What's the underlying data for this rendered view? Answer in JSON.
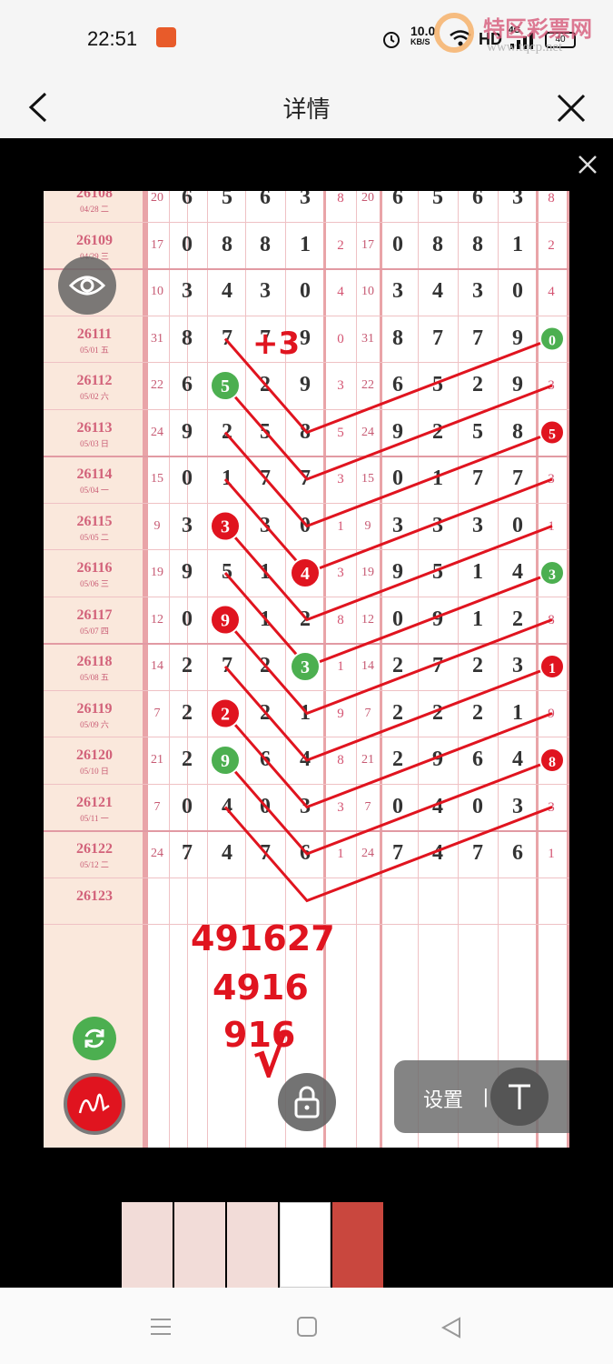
{
  "status_bar": {
    "time": "22:51",
    "network_speed_value": "10.0",
    "network_speed_unit": "KB/S",
    "hd_label": "HD",
    "signal_label": "4G",
    "battery": "40"
  },
  "watermark": {
    "title": "特区彩票网",
    "url": "www.tqcp.net"
  },
  "nav": {
    "title": "详情"
  },
  "sheet": {
    "rows": [
      {
        "issue": "26108",
        "date": "04/28 二",
        "sum_left": "20",
        "digits_left": [
          "6",
          "5",
          "6",
          "3"
        ],
        "tail_left": "8",
        "sum_right": "20",
        "digits_right": [
          "6",
          "5",
          "6",
          "3"
        ],
        "tail_right": "8"
      },
      {
        "issue": "26109",
        "date": "04/29 三",
        "sum_left": "17",
        "digits_left": [
          "0",
          "8",
          "8",
          "1"
        ],
        "tail_left": "2",
        "sum_right": "17",
        "digits_right": [
          "0",
          "8",
          "8",
          "1"
        ],
        "tail_right": "2"
      },
      {
        "issue": "",
        "date": "",
        "sum_left": "10",
        "digits_left": [
          "3",
          "4",
          "3",
          "0"
        ],
        "tail_left": "4",
        "sum_right": "10",
        "digits_right": [
          "3",
          "4",
          "3",
          "0"
        ],
        "tail_right": "4"
      },
      {
        "issue": "26111",
        "date": "05/01 五",
        "sum_left": "31",
        "digits_left": [
          "8",
          "7",
          "7",
          "9"
        ],
        "tail_left": "0",
        "sum_right": "31",
        "digits_right": [
          "8",
          "7",
          "7",
          "9"
        ],
        "tail_right": "0"
      },
      {
        "issue": "26112",
        "date": "05/02 六",
        "sum_left": "22",
        "digits_left": [
          "6",
          "5",
          "2",
          "9"
        ],
        "tail_left": "3",
        "sum_right": "22",
        "digits_right": [
          "6",
          "5",
          "2",
          "9"
        ],
        "tail_right": "3"
      },
      {
        "issue": "26113",
        "date": "05/03 日",
        "sum_left": "24",
        "digits_left": [
          "9",
          "2",
          "5",
          "8"
        ],
        "tail_left": "5",
        "sum_right": "24",
        "digits_right": [
          "9",
          "2",
          "5",
          "8"
        ],
        "tail_right": "5"
      },
      {
        "issue": "26114",
        "date": "05/04 一",
        "sum_left": "15",
        "digits_left": [
          "0",
          "1",
          "7",
          "7"
        ],
        "tail_left": "3",
        "sum_right": "15",
        "digits_right": [
          "0",
          "1",
          "7",
          "7"
        ],
        "tail_right": "3"
      },
      {
        "issue": "26115",
        "date": "05/05 二",
        "sum_left": "9",
        "digits_left": [
          "3",
          "3",
          "3",
          "0"
        ],
        "tail_left": "1",
        "sum_right": "9",
        "digits_right": [
          "3",
          "3",
          "3",
          "0"
        ],
        "tail_right": "1"
      },
      {
        "issue": "26116",
        "date": "05/06 三",
        "sum_left": "19",
        "digits_left": [
          "9",
          "5",
          "1",
          "4"
        ],
        "tail_left": "3",
        "sum_right": "19",
        "digits_right": [
          "9",
          "5",
          "1",
          "4"
        ],
        "tail_right": "3"
      },
      {
        "issue": "26117",
        "date": "05/07 四",
        "sum_left": "12",
        "digits_left": [
          "0",
          "9",
          "1",
          "2"
        ],
        "tail_left": "8",
        "sum_right": "12",
        "digits_right": [
          "0",
          "9",
          "1",
          "2"
        ],
        "tail_right": "8"
      },
      {
        "issue": "26118",
        "date": "05/08 五",
        "sum_left": "14",
        "digits_left": [
          "2",
          "7",
          "2",
          "3"
        ],
        "tail_left": "1",
        "sum_right": "14",
        "digits_right": [
          "2",
          "7",
          "2",
          "3"
        ],
        "tail_right": "1"
      },
      {
        "issue": "26119",
        "date": "05/09 六",
        "sum_left": "7",
        "digits_left": [
          "2",
          "2",
          "2",
          "1"
        ],
        "tail_left": "9",
        "sum_right": "7",
        "digits_right": [
          "2",
          "2",
          "2",
          "1"
        ],
        "tail_right": "9"
      },
      {
        "issue": "26120",
        "date": "05/10 日",
        "sum_left": "21",
        "digits_left": [
          "2",
          "9",
          "6",
          "4"
        ],
        "tail_left": "8",
        "sum_right": "21",
        "digits_right": [
          "2",
          "9",
          "6",
          "4"
        ],
        "tail_right": "8"
      },
      {
        "issue": "26121",
        "date": "05/11 一",
        "sum_left": "7",
        "digits_left": [
          "0",
          "4",
          "0",
          "3"
        ],
        "tail_left": "3",
        "sum_right": "7",
        "digits_right": [
          "0",
          "4",
          "0",
          "3"
        ],
        "tail_right": "3"
      },
      {
        "issue": "26122",
        "date": "05/12 二",
        "sum_left": "24",
        "digits_left": [
          "7",
          "4",
          "7",
          "6"
        ],
        "tail_left": "1",
        "sum_right": "24",
        "digits_right": [
          "7",
          "4",
          "7",
          "6"
        ],
        "tail_right": "1"
      },
      {
        "issue": "26123",
        "date": "",
        "sum_left": "",
        "digits_left": [
          "",
          "",
          "",
          ""
        ],
        "tail_left": "",
        "sum_right": "",
        "digits_right": [
          "",
          "",
          "",
          ""
        ],
        "tail_right": ""
      }
    ]
  },
  "annotations": {
    "plus_note": "+3",
    "prediction_1": "491627",
    "prediction_2": "4916",
    "prediction_3": "916",
    "check_mark": "√"
  },
  "toolbar": {
    "settings_label": "设置",
    "separator": "|",
    "text_tool": "T"
  },
  "colors": {
    "red_marker": "#e0141f",
    "green_marker": "#4caf50",
    "sheet_pink": "#fae8dc",
    "grid_line": "#efc1c4"
  }
}
